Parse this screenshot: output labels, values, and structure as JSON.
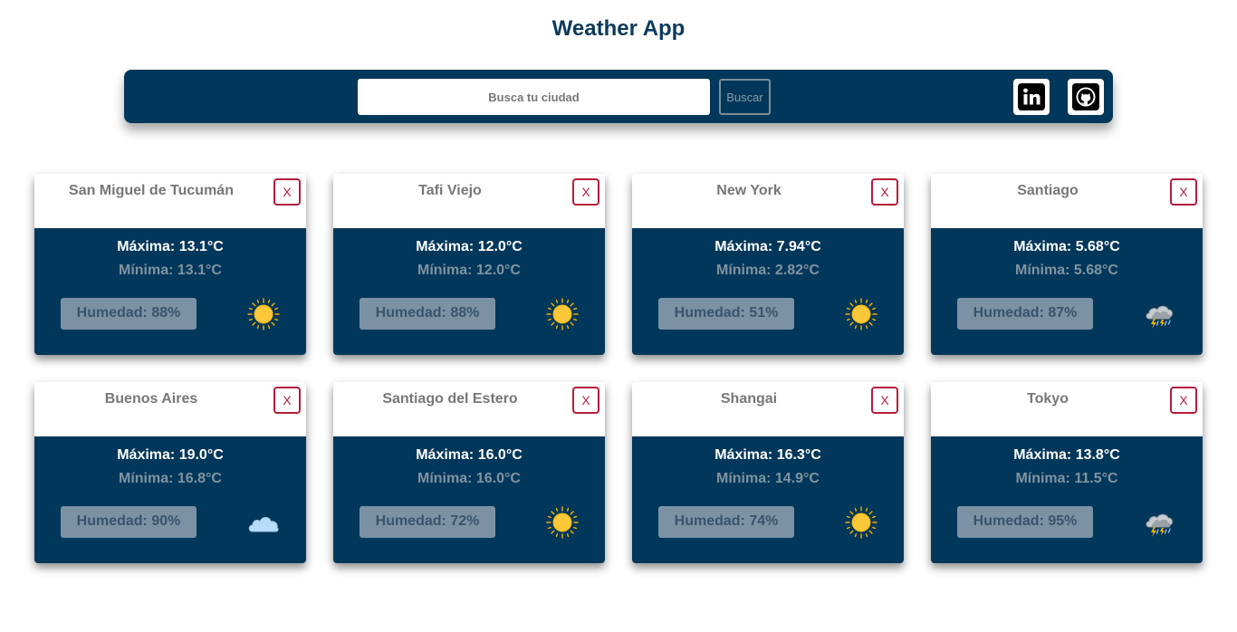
{
  "app": {
    "title": "Weather App"
  },
  "search": {
    "placeholder": "Busca tu ciudad",
    "value": "",
    "button_label": "Buscar"
  },
  "social": {
    "linkedin_icon": "linkedin-icon",
    "github_icon": "github-icon"
  },
  "labels": {
    "max": "Máxima:",
    "min": "Mínima:",
    "humidity": "Humedad:",
    "close": "X"
  },
  "colors": {
    "primary": "#01375a",
    "title": "#0d3a5c",
    "close": "#b51d3b",
    "humidity_bg": "#7b92a5"
  },
  "cities": [
    {
      "name": "San Miguel de Tucumán",
      "max": "13.1°C",
      "min": "13.1°C",
      "humidity": "88%",
      "icon": "sun-icon",
      "max_text": "Máxima:  13.1°C",
      "min_text": "Mínima:  13.1°C",
      "humidity_text": "Humedad: 88%"
    },
    {
      "name": "Tafi Viejo",
      "max": "12.0°C",
      "min": "12.0°C",
      "humidity": "88%",
      "icon": "sun-icon",
      "max_text": "Máxima:  12.0°C",
      "min_text": "Mínima:  12.0°C",
      "humidity_text": "Humedad: 88%"
    },
    {
      "name": "New York",
      "max": "7.94°C",
      "min": "2.82°C",
      "humidity": "51%",
      "icon": "sun-icon",
      "max_text": "Máxima:  7.94°C",
      "min_text": "Mínima:  2.82°C",
      "humidity_text": "Humedad: 51%"
    },
    {
      "name": "Santiago",
      "max": "5.68°C",
      "min": "5.68°C",
      "humidity": "87%",
      "icon": "thunderstorm-icon",
      "max_text": "Máxima:  5.68°C",
      "min_text": "Mínima:  5.68°C",
      "humidity_text": "Humedad: 87%"
    },
    {
      "name": "Buenos Aires",
      "max": "19.0°C",
      "min": "16.8°C",
      "humidity": "90%",
      "icon": "cloud-icon",
      "max_text": "Máxima:  19.0°C",
      "min_text": "Mínima:  16.8°C",
      "humidity_text": "Humedad: 90%"
    },
    {
      "name": "Santiago del Estero",
      "max": "16.0°C",
      "min": "16.0°C",
      "humidity": "72%",
      "icon": "sun-icon",
      "max_text": "Máxima:  16.0°C",
      "min_text": "Mínima:  16.0°C",
      "humidity_text": "Humedad: 72%"
    },
    {
      "name": "Shangai",
      "max": "16.3°C",
      "min": "14.9°C",
      "humidity": "74%",
      "icon": "sun-icon",
      "max_text": "Máxima:  16.3°C",
      "min_text": "Mínima:  14.9°C",
      "humidity_text": "Humedad: 74%"
    },
    {
      "name": "Tokyo",
      "max": "13.8°C",
      "min": "11.5°C",
      "humidity": "95%",
      "icon": "thunderstorm-icon",
      "max_text": "Máxima:  13.8°C",
      "min_text": "Mínima:  11.5°C",
      "humidity_text": "Humedad: 95%"
    }
  ]
}
